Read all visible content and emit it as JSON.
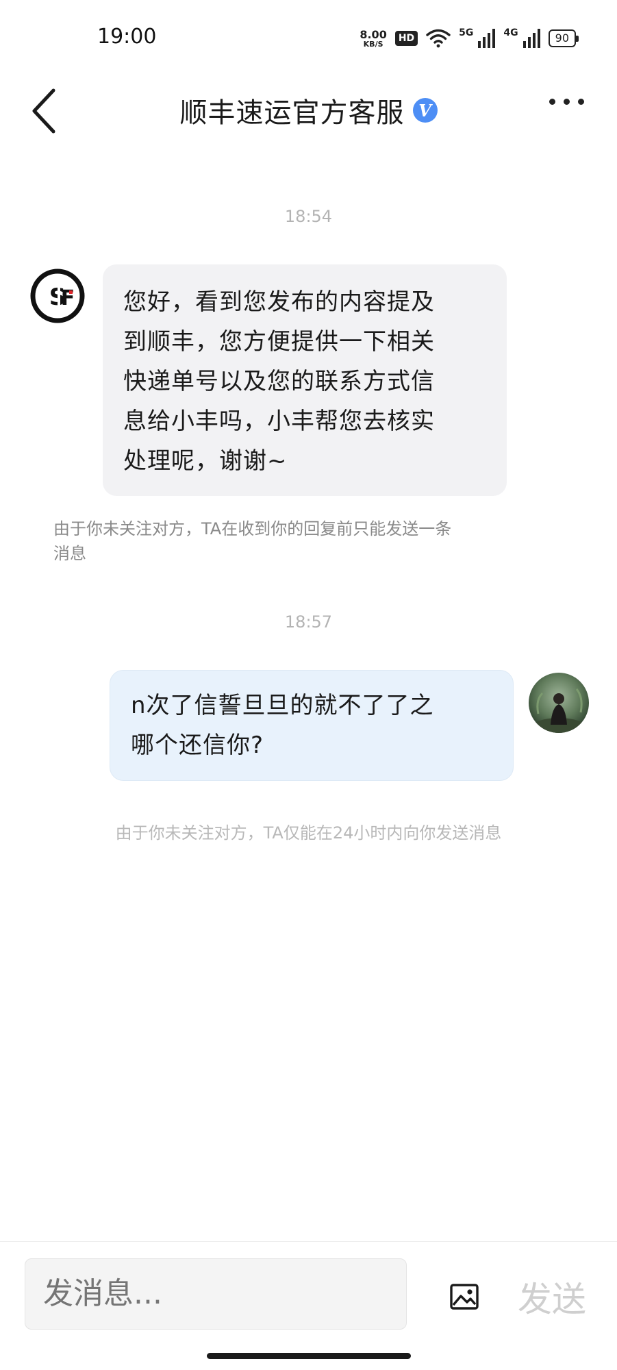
{
  "status_bar": {
    "time": "19:00",
    "speed_value": "8.00",
    "speed_unit": "KB/S",
    "hd_label": "HD",
    "net_5g": "5G",
    "net_4g": "4G",
    "battery": "90"
  },
  "header": {
    "title": "顺丰速运官方客服",
    "verified_badge": "V"
  },
  "chat": {
    "messages": [
      {
        "time": "18:54",
        "sender": "sf",
        "text_lines": [
          "您好，看到您发布的内容提及",
          "到顺丰，您方便提供一下相关",
          "快递单号以及您的联系方式信",
          "息给小丰吗，小丰帮您去核实",
          "处理呢，谢谢~"
        ],
        "avatar_text": "SF"
      },
      {
        "time": "18:57",
        "sender": "me",
        "text_lines": [
          "n次了信誓旦旦的就不了了之",
          "哪个还信你?"
        ]
      }
    ],
    "notice_1_lines": [
      "由于你未关注对方，TA在收到你的回复前只能发送一条",
      "消息"
    ],
    "notice_2": "由于你未关注对方，TA仅能在24小时内向你发送消息"
  },
  "input": {
    "placeholder": "发消息...",
    "send_label": "发送"
  },
  "colors": {
    "verified": "#4d8ef5",
    "incoming_bubble": "#f2f2f4",
    "outgoing_bubble": "#e8f2fc",
    "sf_red": "#e0262b"
  }
}
